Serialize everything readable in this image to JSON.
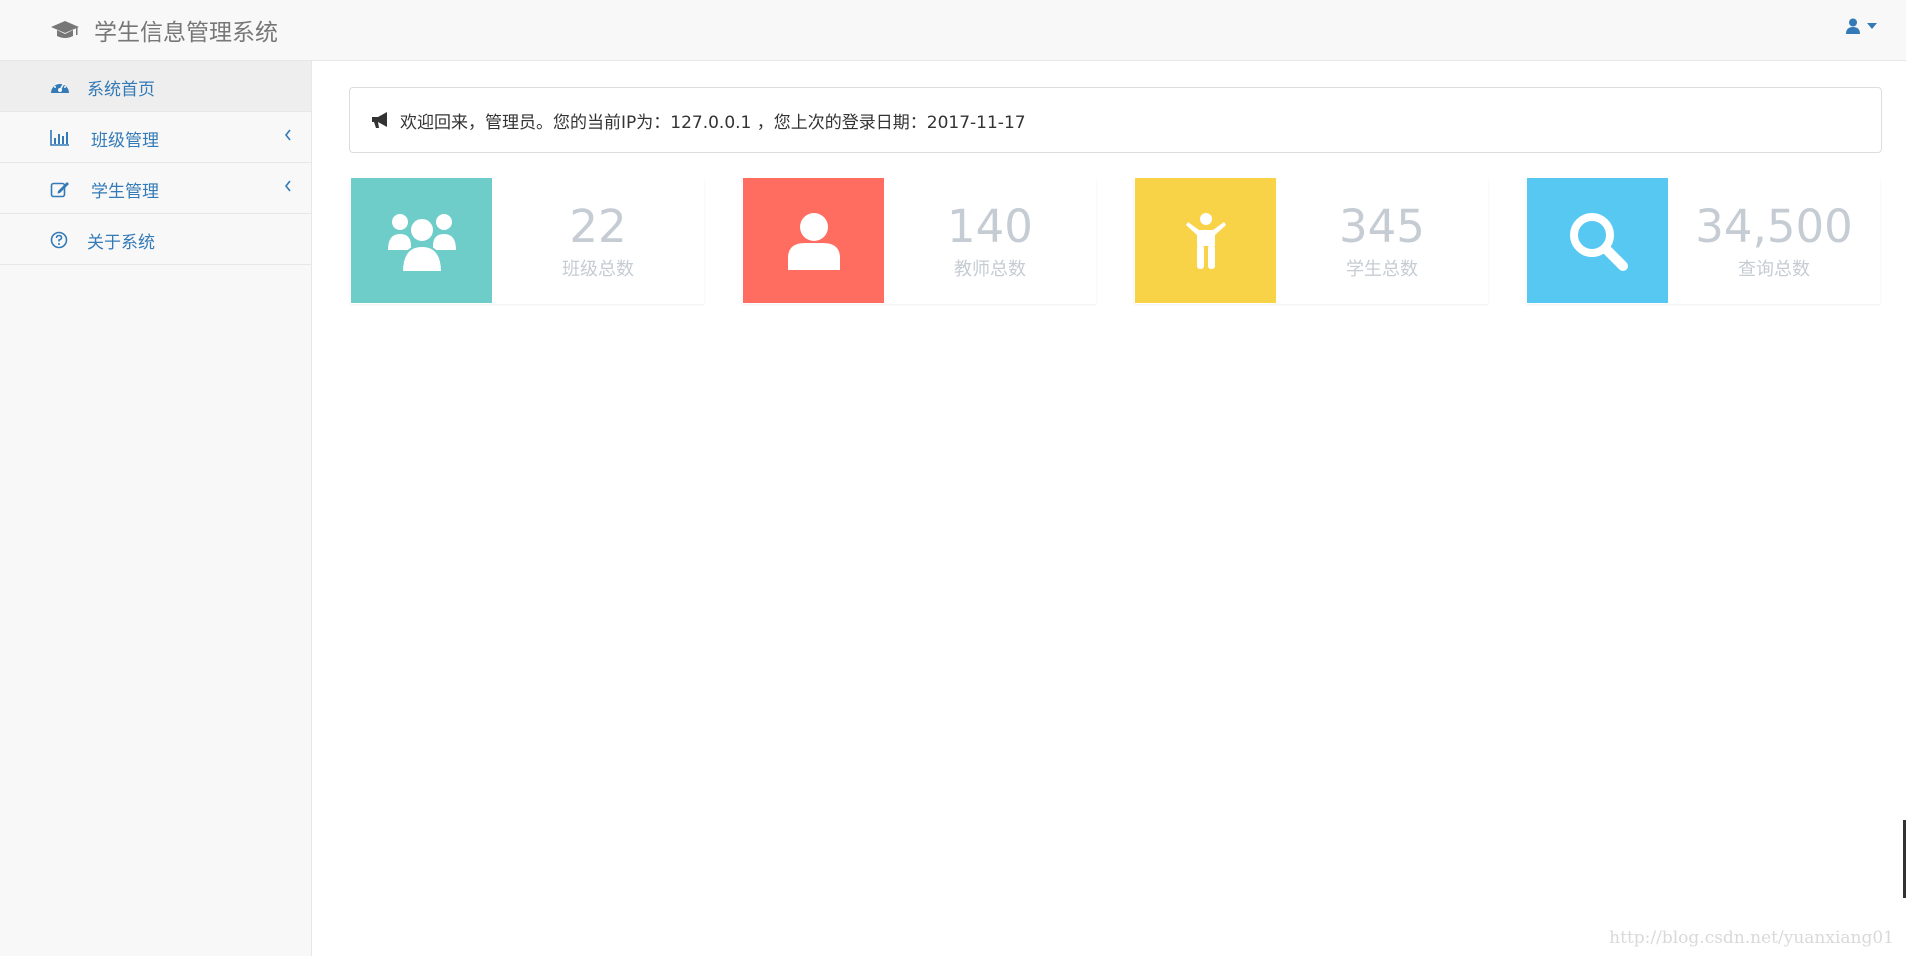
{
  "navbar": {
    "brand": "学生信息管理系统",
    "brand_icon": "graduation-cap-icon",
    "user_icon": "user-icon"
  },
  "sidebar": {
    "items": [
      {
        "label": "系统首页",
        "icon": "dashboard-icon",
        "active": true,
        "expandable": false
      },
      {
        "label": "班级管理",
        "icon": "bar-chart-icon",
        "active": false,
        "expandable": true
      },
      {
        "label": "学生管理",
        "icon": "edit-icon",
        "active": false,
        "expandable": true
      },
      {
        "label": "关于系统",
        "icon": "question-circle-icon",
        "active": false,
        "expandable": false
      }
    ]
  },
  "welcome": {
    "icon": "bullhorn-icon",
    "message": "欢迎回来，管理员。您的当前IP为：127.0.0.1 ，您上次的登录日期：2017-11-17"
  },
  "stats": [
    {
      "value": "22",
      "label": "班级总数",
      "icon": "users-icon",
      "color": "#6ecdc9"
    },
    {
      "value": "140",
      "label": "教师总数",
      "icon": "user-icon",
      "color": "#ff6c60"
    },
    {
      "value": "345",
      "label": "学生总数",
      "icon": "child-icon",
      "color": "#f8d347"
    },
    {
      "value": "34,500",
      "label": "查询总数",
      "icon": "search-icon",
      "color": "#57c8f2"
    }
  ],
  "watermark": "http://blog.csdn.net/yuanxiang01",
  "colors": {
    "link": "#337ab7",
    "navbar_bg": "#f8f8f8",
    "stat_text": "#c6ccd3"
  }
}
